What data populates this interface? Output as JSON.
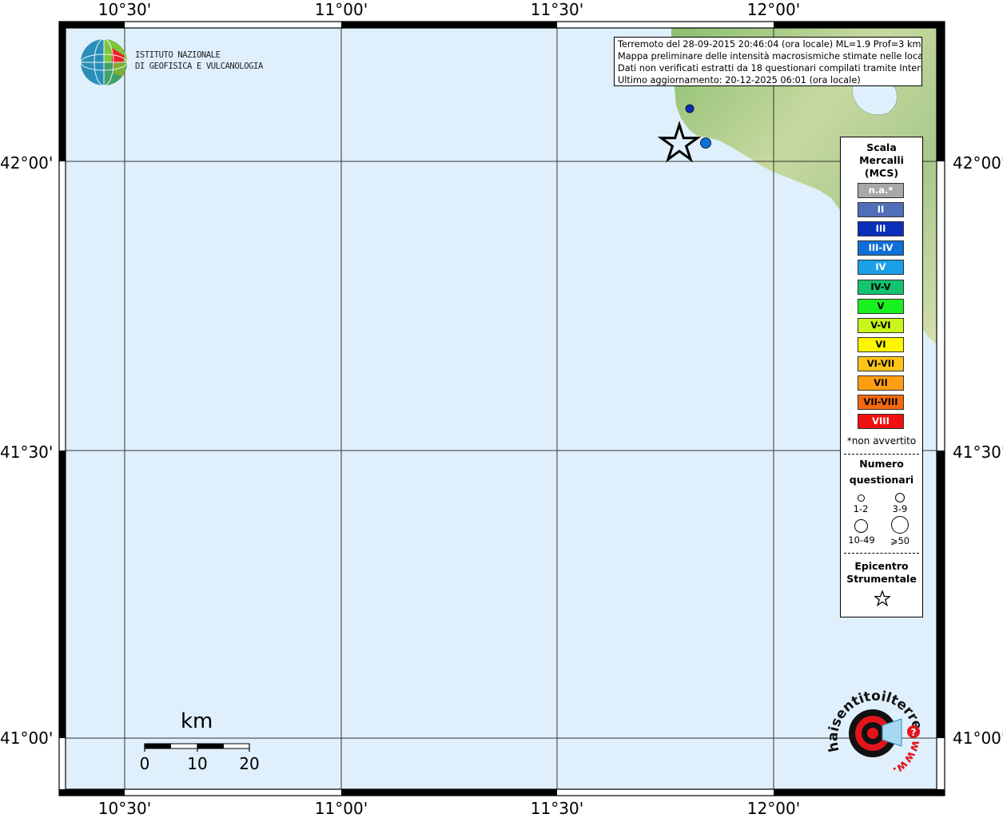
{
  "info": {
    "line1": "Terremoto del 28-09-2015 20:46:04 (ora locale) ML=1.9 Prof=3 km",
    "line2": "Mappa preliminare delle intensità macrosismiche stimate nelle località",
    "line3": "Dati non verificati estratti da 18 questionari compilati tramite Internet.",
    "line4": "Ultimo aggiornamento: 20-12-2025 06:01 (ora locale)"
  },
  "logo": {
    "line1": "ISTITUTO NAZIONALE",
    "line2": "DI GEOFISICA E VULCANOLOGIA"
  },
  "axes": {
    "x_ticks": [
      "10°30'",
      "11°00'",
      "11°30'",
      "12°00'"
    ],
    "y_ticks": [
      "42°00'",
      "41°30'",
      "41°00'"
    ]
  },
  "scalebar": {
    "unit": "km",
    "labels": [
      "0",
      "10",
      "20"
    ]
  },
  "legend": {
    "title1": "Scala",
    "title2": "Mercalli",
    "title3": "(MCS)",
    "classes": [
      {
        "label": "n.a.*",
        "color": "#a8a8a8",
        "text": "#ffffff"
      },
      {
        "label": "II",
        "color": "#4f6fb8",
        "text": "#ffffff"
      },
      {
        "label": "III",
        "color": "#0a2fb8",
        "text": "#ffffff"
      },
      {
        "label": "III-IV",
        "color": "#0f6fd8",
        "text": "#ffffff"
      },
      {
        "label": "IV",
        "color": "#1a9fe8",
        "text": "#ffffff"
      },
      {
        "label": "IV-V",
        "color": "#13c36f",
        "text": "#000000"
      },
      {
        "label": "V",
        "color": "#19f020",
        "text": "#000000"
      },
      {
        "label": "V-VI",
        "color": "#c8f51a",
        "text": "#000000"
      },
      {
        "label": "VI",
        "color": "#fff500",
        "text": "#000000"
      },
      {
        "label": "VI-VII",
        "color": "#ffc41a",
        "text": "#000000"
      },
      {
        "label": "VII",
        "color": "#ff9e12",
        "text": "#000000"
      },
      {
        "label": "VII-VIII",
        "color": "#f26a10",
        "text": "#000000"
      },
      {
        "label": "VIII",
        "color": "#f01010",
        "text": "#ffffff"
      }
    ],
    "na_note": "*non avvertito",
    "count_title1": "Numero",
    "count_title2": "questionari",
    "counts": [
      "1-2",
      "3-9",
      "10-49",
      "⩾50"
    ],
    "epi_title1": "Epicentro",
    "epi_title2": "Strumentale"
  },
  "observations": [
    {
      "intensity": "III",
      "color": "#0a2fb8"
    },
    {
      "intensity": "III-IV",
      "color": "#0f6fd8"
    }
  ],
  "watermark": {
    "text_top": "haisentitoilterremoto.it",
    "text_bottom": "www.",
    "accent": "#e3141c"
  },
  "colors": {
    "sea": "#dff0fc",
    "land": "#b6d497"
  }
}
